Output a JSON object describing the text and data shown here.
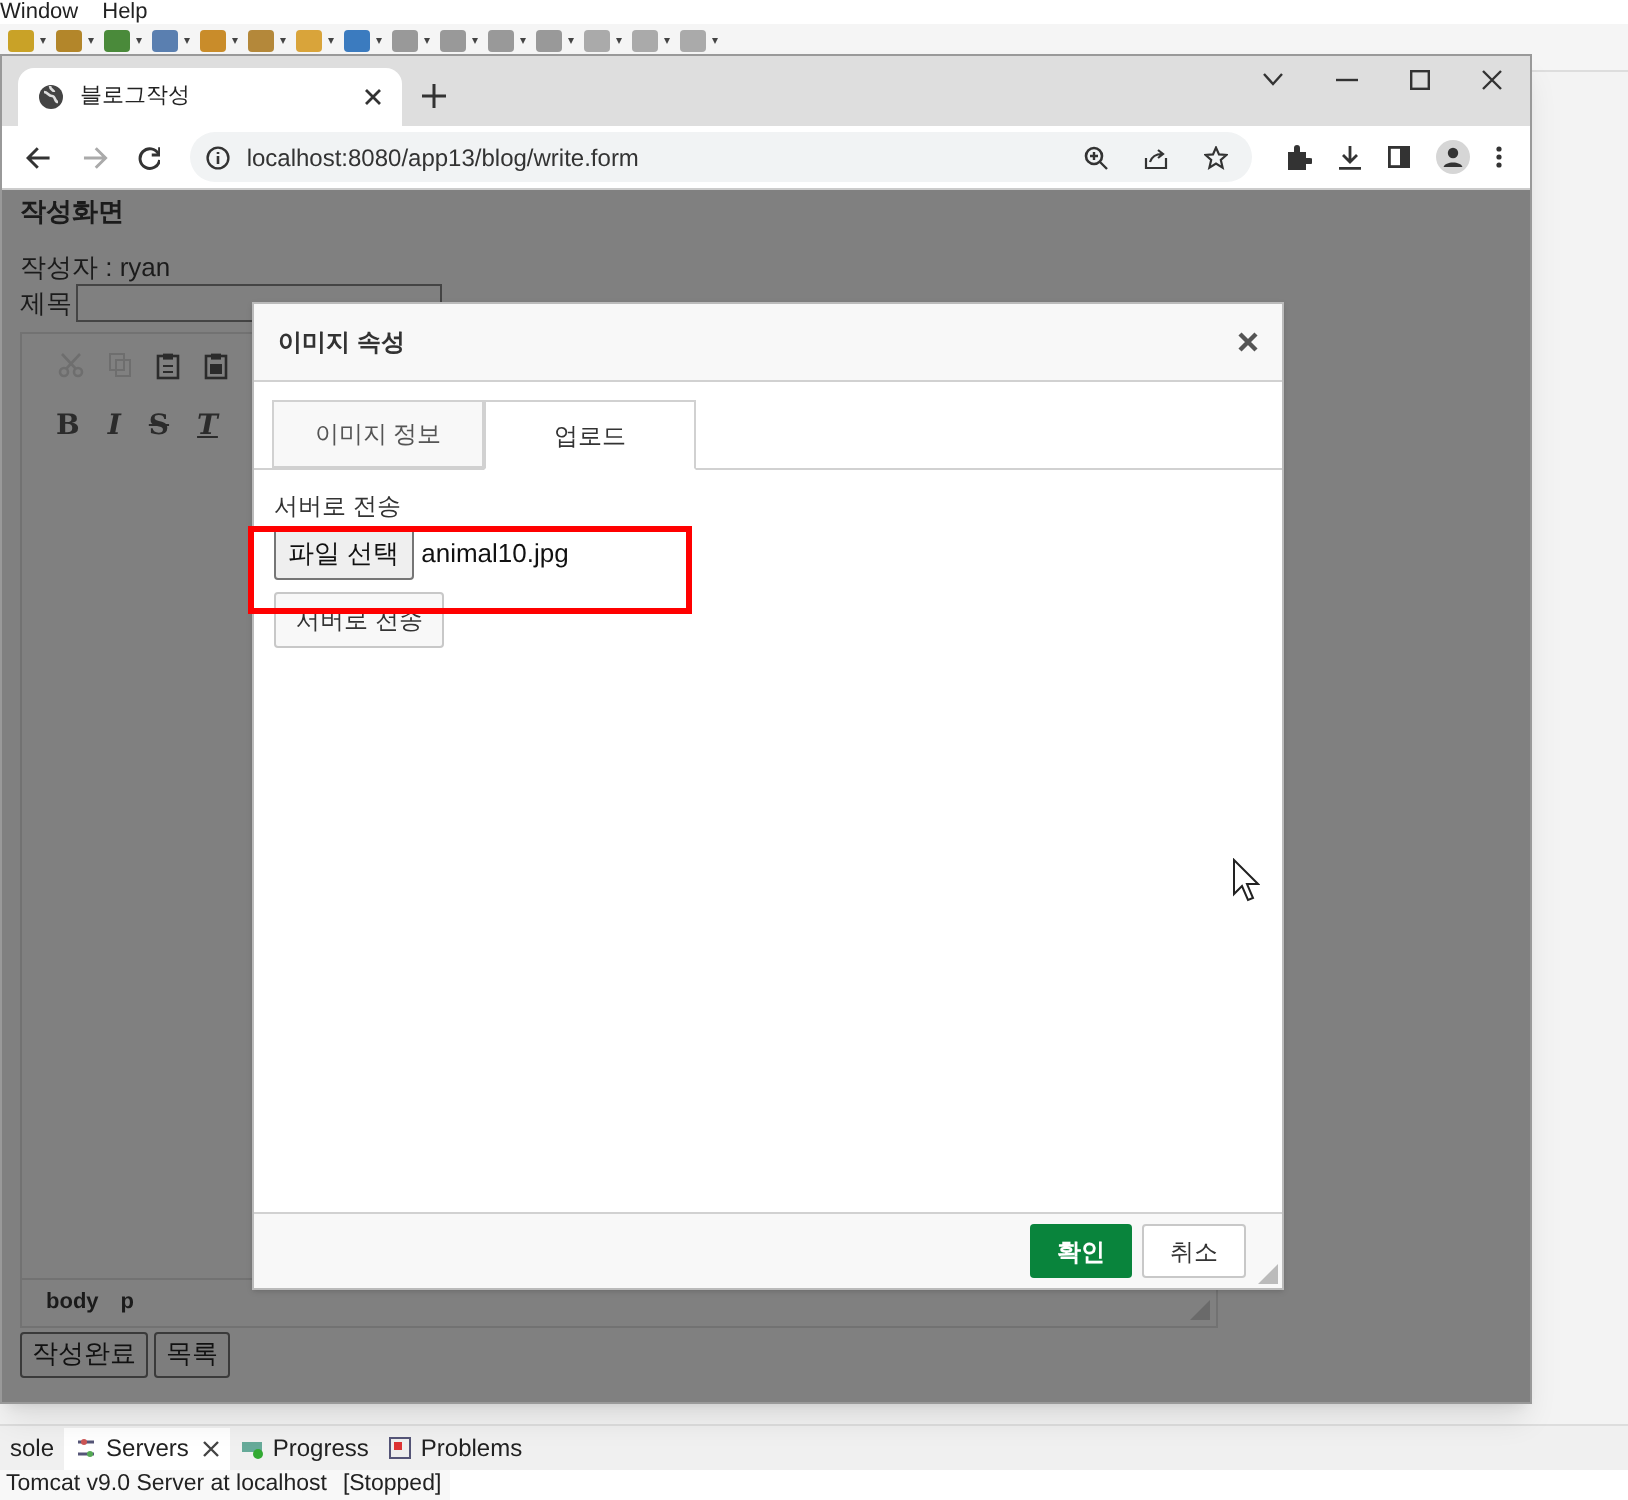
{
  "eclipse": {
    "menu": [
      "Window",
      "Help"
    ],
    "bottom_tabs": [
      {
        "label": "sole",
        "selected": false,
        "closable": false
      },
      {
        "label": "Servers",
        "selected": true,
        "closable": true
      },
      {
        "label": "Progress",
        "selected": false,
        "closable": false
      },
      {
        "label": "Problems",
        "selected": false,
        "closable": false
      }
    ],
    "server": {
      "name": "Tomcat v9.0 Server at localhost",
      "state": "[Stopped]"
    }
  },
  "browser": {
    "tab": {
      "title": "블로그작성"
    },
    "url": "localhost:8080/app13/blog/write.form"
  },
  "page": {
    "heading": "작성화면",
    "author": "작성자 : ryan",
    "title_label": "제목",
    "format_buttons": [
      "B",
      "I",
      "S",
      "T"
    ],
    "path": [
      "body",
      "p"
    ],
    "buttons": [
      "작성완료",
      "목록"
    ]
  },
  "dialog": {
    "title": "이미지 속성",
    "tabs": [
      {
        "label": "이미지 정보",
        "selected": false
      },
      {
        "label": "업로드",
        "selected": true
      }
    ],
    "upload_label": "서버로 전송",
    "file_button": "파일 선택",
    "file_name": "animal10.jpg",
    "send_button": "서버로 전송",
    "ok": "확인",
    "cancel": "취소"
  }
}
